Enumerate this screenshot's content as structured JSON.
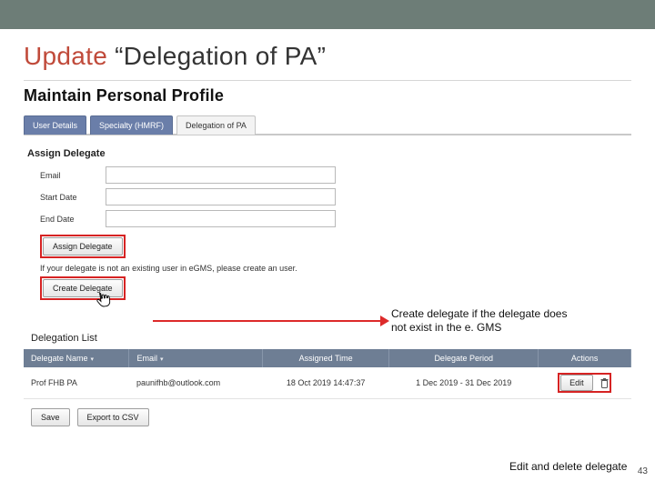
{
  "slide": {
    "title_word1": "Update",
    "title_rest": " “Delegation of PA”",
    "page_number": "43"
  },
  "app": {
    "title": "Maintain Personal Profile",
    "tabs": {
      "user_details": "User Details",
      "specialty": "Specialty (HMRF)",
      "delegation": "Delegation of PA"
    }
  },
  "assign": {
    "heading": "Assign Delegate",
    "email_label": "Email",
    "email_value": "",
    "start_label": "Start Date",
    "start_value": "",
    "end_label": "End Date",
    "end_value": "",
    "assign_btn": "Assign Delegate",
    "note": "If your delegate is not an existing user in eGMS, please create an user.",
    "create_btn": "Create Delegate"
  },
  "callouts": {
    "create": "Create delegate if the delegate does not exist in the e. GMS",
    "edit_delete": "Edit and delete delegate"
  },
  "list": {
    "heading": "Delegation List",
    "cols": {
      "name": "Delegate Name",
      "email": "Email",
      "assigned": "Assigned Time",
      "period": "Delegate Period",
      "actions": "Actions"
    },
    "row": {
      "name": "Prof FHB PA",
      "email": "paunifhb@outlook.com",
      "assigned": "18 Oct 2019 14:47:37",
      "period": "1 Dec 2019 - 31 Dec 2019",
      "edit": "Edit"
    }
  },
  "footer": {
    "save": "Save",
    "export": "Export to CSV"
  },
  "icons": {
    "sort": "▾"
  }
}
